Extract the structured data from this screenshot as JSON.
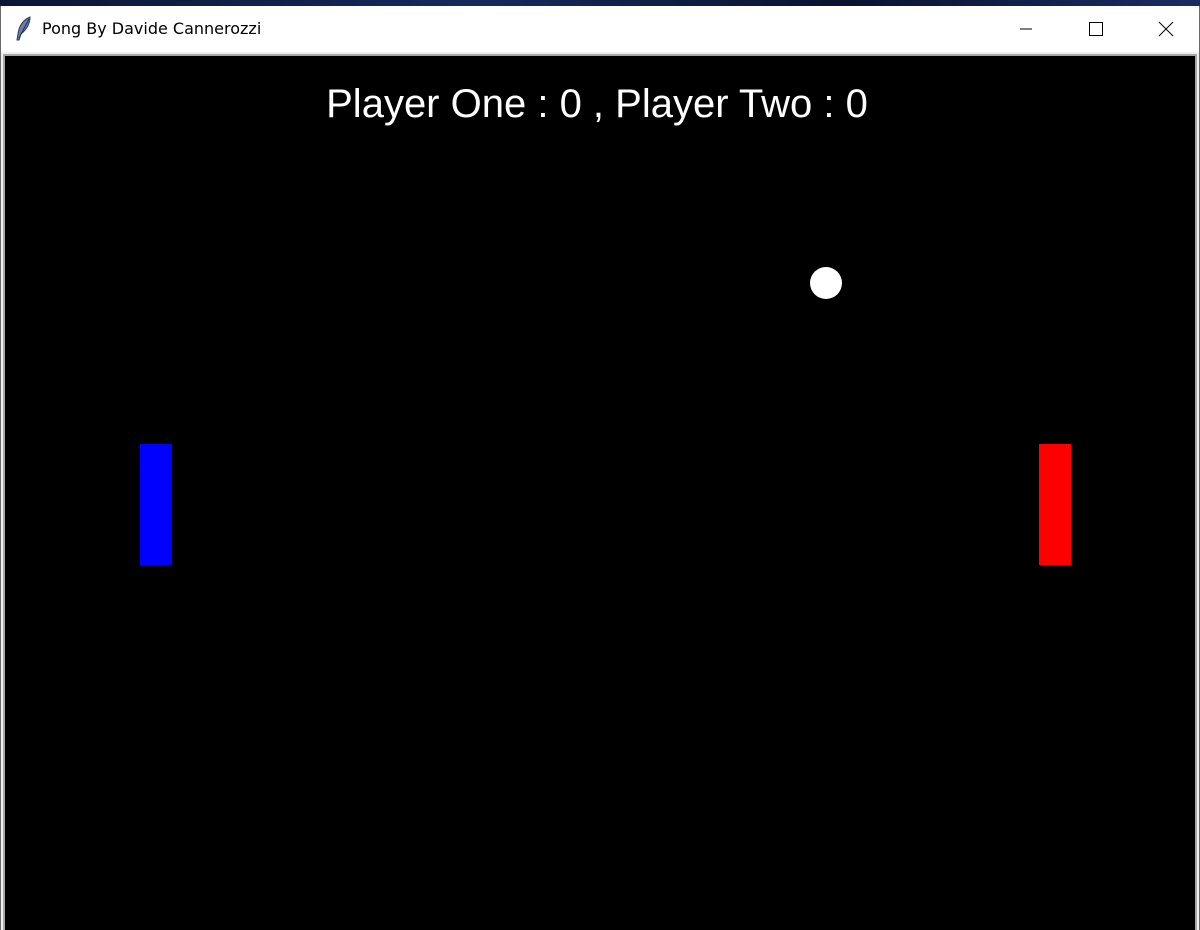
{
  "window": {
    "title": "Pong By Davide Cannerozzi",
    "icon": "feather-icon",
    "controls": {
      "minimize_icon": "minimize-icon",
      "maximize_icon": "maximize-icon",
      "close_icon": "close-icon"
    }
  },
  "game": {
    "score_text": "Player One : 0 , Player Two : 0",
    "player_one_score": 0,
    "player_two_score": 0,
    "colors": {
      "background": "#000000",
      "text": "#ffffff",
      "ball": "#ffffff",
      "left_paddle": "#0000ff",
      "right_paddle": "#ff0000"
    }
  }
}
